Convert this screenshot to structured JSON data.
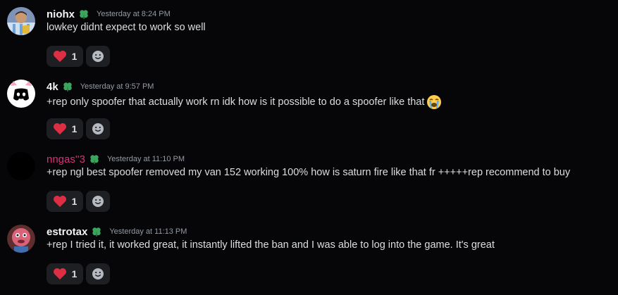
{
  "colors": {
    "background": "#060608",
    "username_default": "#f2f3f5",
    "username_pink": "#d9307a",
    "badge_green": "#3ba55d",
    "reaction_bg": "#1e1f23",
    "timestamp": "#949ba4"
  },
  "messages": [
    {
      "username": "niohx",
      "badge_icon": "clover-badge-icon",
      "timestamp": "Yesterday at 8:24 PM",
      "text": "lowkey didnt expect to work so well",
      "reaction": {
        "emoji": "heart-icon",
        "count": "1"
      }
    },
    {
      "username": "4k",
      "badge_icon": "clover-badge-icon",
      "timestamp": "Yesterday at 9:57 PM",
      "text": "+rep only spoofer that actually work rn idk how is it possible to do a spoofer like that",
      "trailing_emoji": "crying-face-icon",
      "reaction": {
        "emoji": "heart-icon",
        "count": "1"
      }
    },
    {
      "username": "nngas''3",
      "badge_icon": "clover-badge-icon",
      "timestamp": "Yesterday at 11:10 PM",
      "text": "+rep ngl best spoofer removed my van 152 working 100% how is saturn fire like that fr +++++rep recommend to buy",
      "reaction": {
        "emoji": "heart-icon",
        "count": "1"
      }
    },
    {
      "username": "estrotax",
      "badge_icon": "clover-badge-icon",
      "timestamp": "Yesterday at 11:13 PM",
      "text": "+rep I tried it, it worked great, it instantly lifted the ban and I was able to log into the game. It's great",
      "reaction": {
        "emoji": "heart-icon",
        "count": "1"
      }
    }
  ]
}
